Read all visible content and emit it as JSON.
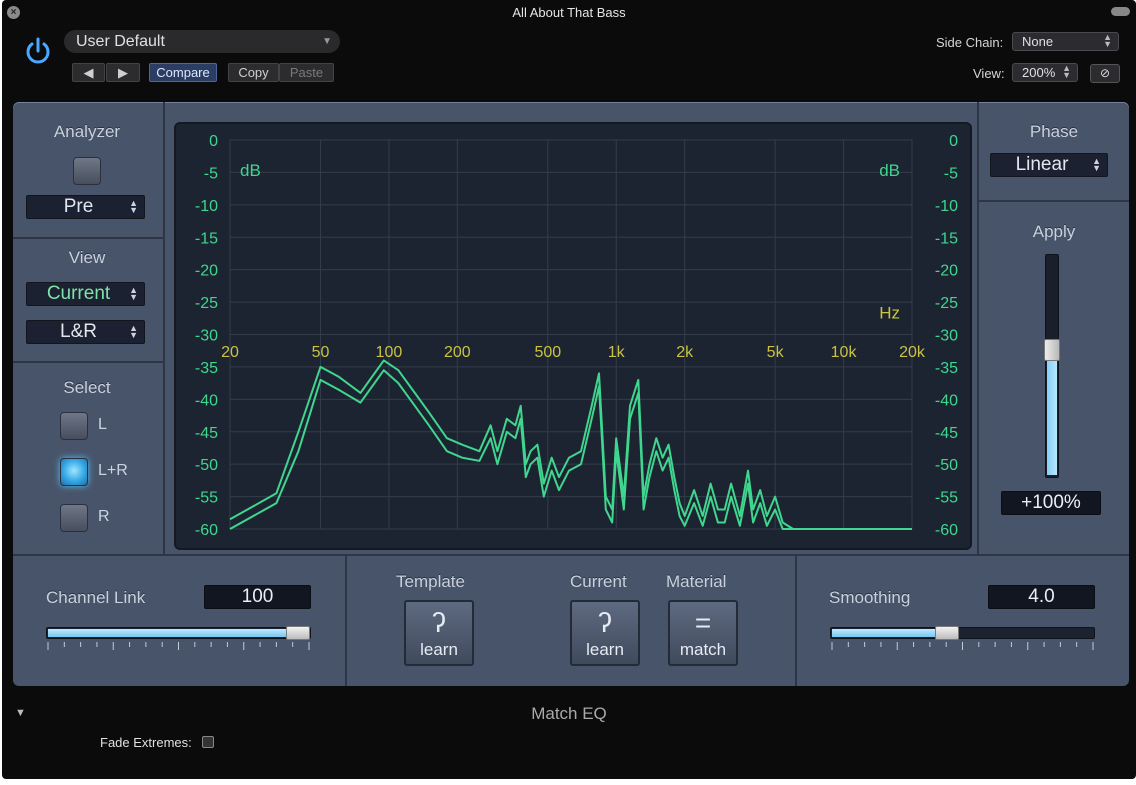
{
  "window": {
    "title": "All About That Bass",
    "footer_title": "Match EQ"
  },
  "header": {
    "preset": "User Default",
    "prev_label": "◀",
    "next_label": "▶",
    "compare_label": "Compare",
    "copy_label": "Copy",
    "paste_label": "Paste",
    "side_chain_label": "Side Chain:",
    "side_chain_value": "None",
    "view_label": "View:",
    "view_value": "200%",
    "link_icon": "link-icon"
  },
  "left": {
    "analyzer_label": "Analyzer",
    "analyzer_on": false,
    "analyzer_mode": "Pre",
    "view_label": "View",
    "view_value": "Current",
    "channel_value": "L&R",
    "select_label": "Select",
    "select_options": [
      "L",
      "L+R",
      "R"
    ],
    "select_active": "L+R"
  },
  "right": {
    "phase_label": "Phase",
    "phase_value": "Linear",
    "apply_label": "Apply",
    "apply_value": "+100%",
    "apply_level": 0.58
  },
  "bottom": {
    "channel_link_label": "Channel Link",
    "channel_link_value": "100",
    "channel_link_level": 1.0,
    "template_label": "Template",
    "current_label": "Current",
    "material_label": "Material",
    "learn_label": "learn",
    "match_label": "match",
    "smoothing_label": "Smoothing",
    "smoothing_value": "4.0",
    "smoothing_level": 0.44
  },
  "footer": {
    "fade_extremes_label": "Fade Extremes:",
    "fade_extremes_checked": false
  },
  "colors": {
    "curve": "#3fd68e",
    "panel": "#48546a",
    "graph_bg": "#1d2431",
    "freq_labels": "#c9c341"
  },
  "chart_data": {
    "type": "line",
    "x_scale": "log",
    "xlim": [
      20,
      20000
    ],
    "ylim": [
      -60,
      0
    ],
    "y_ticks": [
      "0",
      "-5",
      "-10",
      "-15",
      "-20",
      "-25",
      "-30",
      "-35",
      "-40",
      "-45",
      "-50",
      "-55",
      "-60"
    ],
    "y_unit": "dB",
    "x_unit": "Hz",
    "x_ticks": [
      {
        "label": "20",
        "value": 20
      },
      {
        "label": "50",
        "value": 50
      },
      {
        "label": "100",
        "value": 100
      },
      {
        "label": "200",
        "value": 200
      },
      {
        "label": "500",
        "value": 500
      },
      {
        "label": "1k",
        "value": 1000
      },
      {
        "label": "2k",
        "value": 2000
      },
      {
        "label": "5k",
        "value": 5000
      },
      {
        "label": "10k",
        "value": 10000
      },
      {
        "label": "20k",
        "value": 20000
      }
    ],
    "series": [
      {
        "points": [
          [
            20,
            -58.5
          ],
          [
            32,
            -54.5
          ],
          [
            40,
            -45
          ],
          [
            50,
            -35
          ],
          [
            60,
            -36.5
          ],
          [
            75,
            -39
          ],
          [
            95,
            -34
          ],
          [
            110,
            -35.5
          ],
          [
            130,
            -39
          ],
          [
            150,
            -42
          ],
          [
            180,
            -46
          ],
          [
            210,
            -47
          ],
          [
            250,
            -48
          ],
          [
            280,
            -44
          ],
          [
            300,
            -48
          ],
          [
            330,
            -43
          ],
          [
            360,
            -44
          ],
          [
            380,
            -41
          ],
          [
            400,
            -50
          ],
          [
            420,
            -48
          ],
          [
            450,
            -47
          ],
          [
            480,
            -53
          ],
          [
            520,
            -49
          ],
          [
            560,
            -52
          ],
          [
            620,
            -49
          ],
          [
            700,
            -48
          ],
          [
            780,
            -41
          ],
          [
            840,
            -36
          ],
          [
            900,
            -55
          ],
          [
            960,
            -57
          ],
          [
            1000,
            -46
          ],
          [
            1080,
            -55
          ],
          [
            1150,
            -41
          ],
          [
            1250,
            -37
          ],
          [
            1320,
            -55
          ],
          [
            1400,
            -50
          ],
          [
            1500,
            -46
          ],
          [
            1600,
            -49
          ],
          [
            1700,
            -47
          ],
          [
            1800,
            -52
          ],
          [
            1900,
            -56
          ],
          [
            2000,
            -58
          ],
          [
            2200,
            -54
          ],
          [
            2400,
            -58
          ],
          [
            2600,
            -53
          ],
          [
            2800,
            -57
          ],
          [
            3000,
            -57
          ],
          [
            3200,
            -53
          ],
          [
            3500,
            -58
          ],
          [
            3800,
            -51
          ],
          [
            4000,
            -57
          ],
          [
            4300,
            -54
          ],
          [
            4600,
            -58
          ],
          [
            5000,
            -55
          ],
          [
            5400,
            -59
          ],
          [
            6000,
            -60
          ],
          [
            20000,
            -60
          ]
        ]
      },
      {
        "points": [
          [
            20,
            -60
          ],
          [
            32,
            -56
          ],
          [
            40,
            -48
          ],
          [
            50,
            -37
          ],
          [
            60,
            -38.5
          ],
          [
            75,
            -40.5
          ],
          [
            95,
            -35.5
          ],
          [
            110,
            -37.5
          ],
          [
            130,
            -41
          ],
          [
            150,
            -44
          ],
          [
            180,
            -48
          ],
          [
            210,
            -49
          ],
          [
            250,
            -49.5
          ],
          [
            280,
            -46
          ],
          [
            300,
            -50
          ],
          [
            330,
            -45
          ],
          [
            360,
            -46
          ],
          [
            380,
            -43
          ],
          [
            400,
            -52
          ],
          [
            420,
            -50
          ],
          [
            450,
            -49
          ],
          [
            480,
            -55
          ],
          [
            520,
            -51
          ],
          [
            560,
            -54
          ],
          [
            620,
            -51
          ],
          [
            700,
            -50
          ],
          [
            780,
            -43
          ],
          [
            840,
            -38
          ],
          [
            900,
            -57
          ],
          [
            960,
            -59
          ],
          [
            1000,
            -48
          ],
          [
            1080,
            -57
          ],
          [
            1150,
            -43
          ],
          [
            1250,
            -39
          ],
          [
            1320,
            -57
          ],
          [
            1400,
            -52
          ],
          [
            1500,
            -48
          ],
          [
            1600,
            -51
          ],
          [
            1700,
            -49
          ],
          [
            1800,
            -54
          ],
          [
            1900,
            -58
          ],
          [
            2000,
            -59.5
          ],
          [
            2200,
            -56
          ],
          [
            2400,
            -59.5
          ],
          [
            2600,
            -55
          ],
          [
            2800,
            -59
          ],
          [
            3000,
            -59
          ],
          [
            3200,
            -55
          ],
          [
            3500,
            -59.5
          ],
          [
            3800,
            -53
          ],
          [
            4000,
            -59
          ],
          [
            4300,
            -56
          ],
          [
            4600,
            -59.5
          ],
          [
            5000,
            -57
          ],
          [
            5400,
            -60
          ],
          [
            6000,
            -60
          ],
          [
            20000,
            -60
          ]
        ]
      }
    ]
  }
}
